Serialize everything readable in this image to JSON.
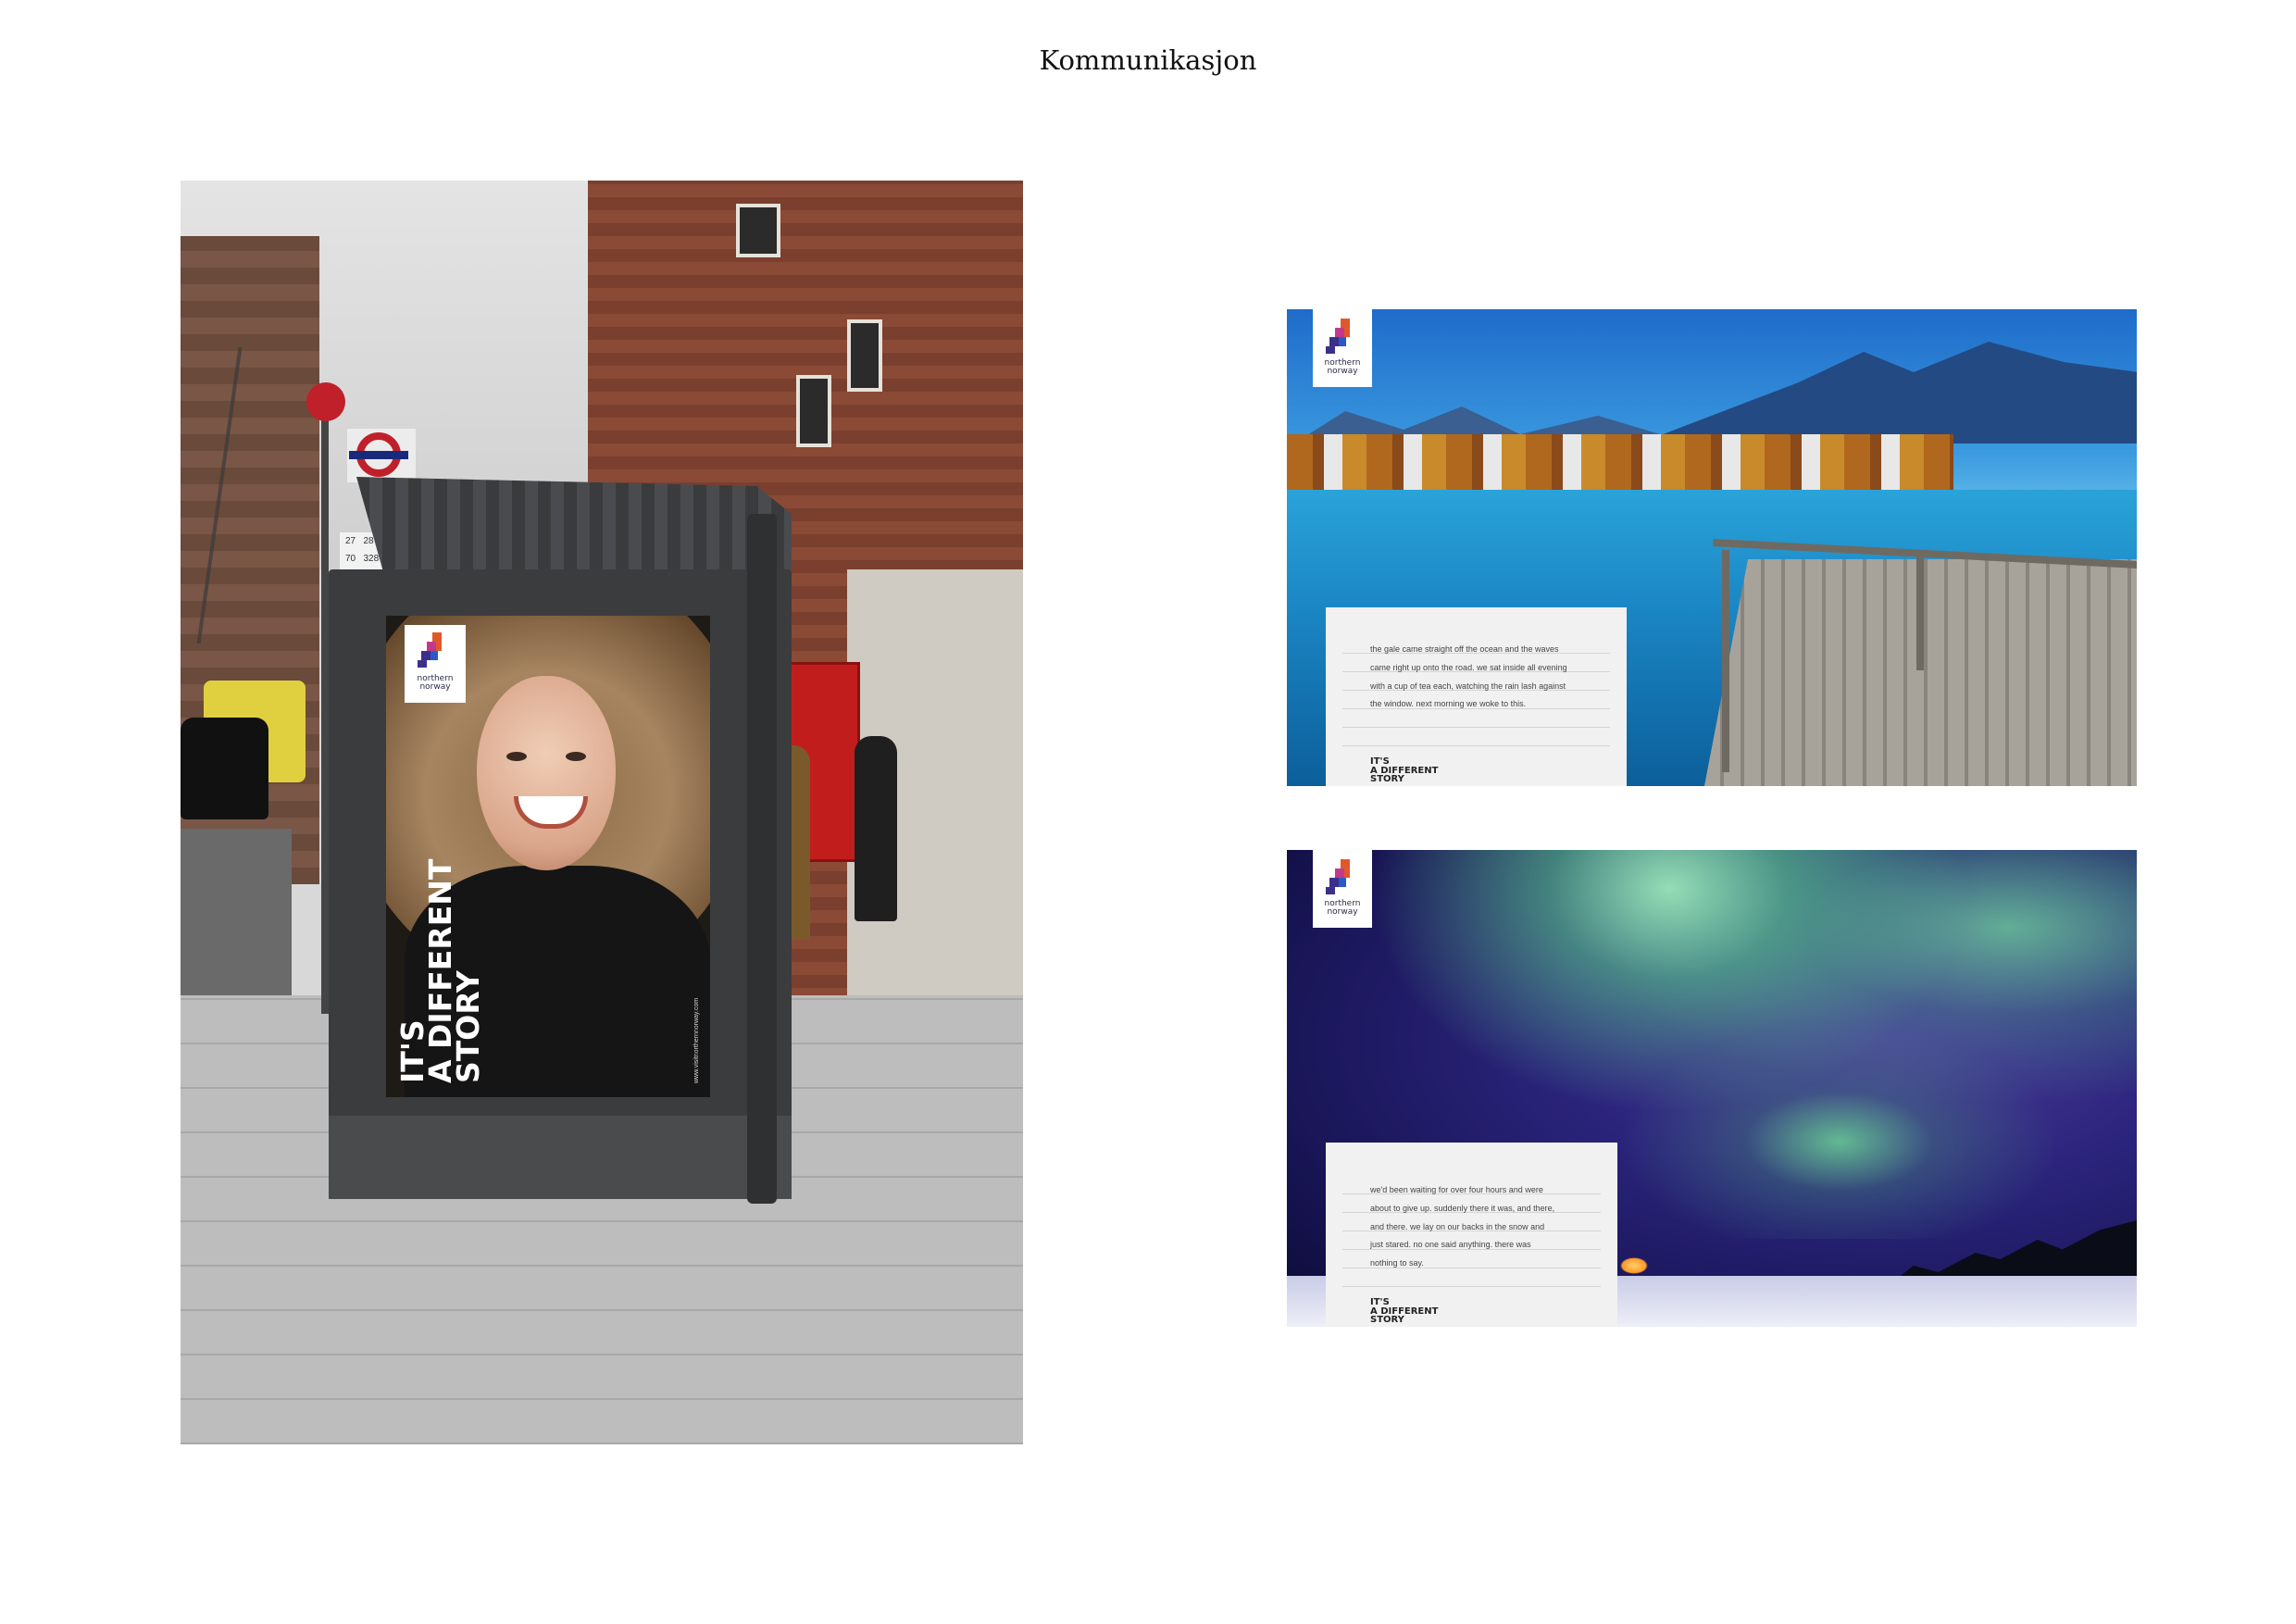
{
  "page": {
    "title": "Kommunikasjon"
  },
  "brand": {
    "logo_line1": "northern",
    "logo_line2": "norway",
    "tagline": "IT'S\nA DIFFERENT\nSTORY",
    "colors": {
      "purple": "#3a2f8a",
      "magenta": "#c2388a",
      "orange": "#e0582a",
      "blue": "#2a58c8"
    }
  },
  "street_scene": {
    "bus_timetable": [
      "27",
      "28",
      "70",
      "328"
    ],
    "ad_url": "www.visitnorthernnorway.com"
  },
  "banner_fjord": {
    "story": "the gale came straight off the ocean and the waves\ncame right up onto the road. we sat inside all evening\nwith a cup of tea each, watching the rain lash against\nthe window. next morning we woke to this."
  },
  "banner_aurora": {
    "story": "we'd been waiting for over four hours and were\nabout to give up. suddenly there it was, and there,\nand there. we lay on our backs in the snow and\njust stared. no one said anything. there was\nnothing to say."
  }
}
